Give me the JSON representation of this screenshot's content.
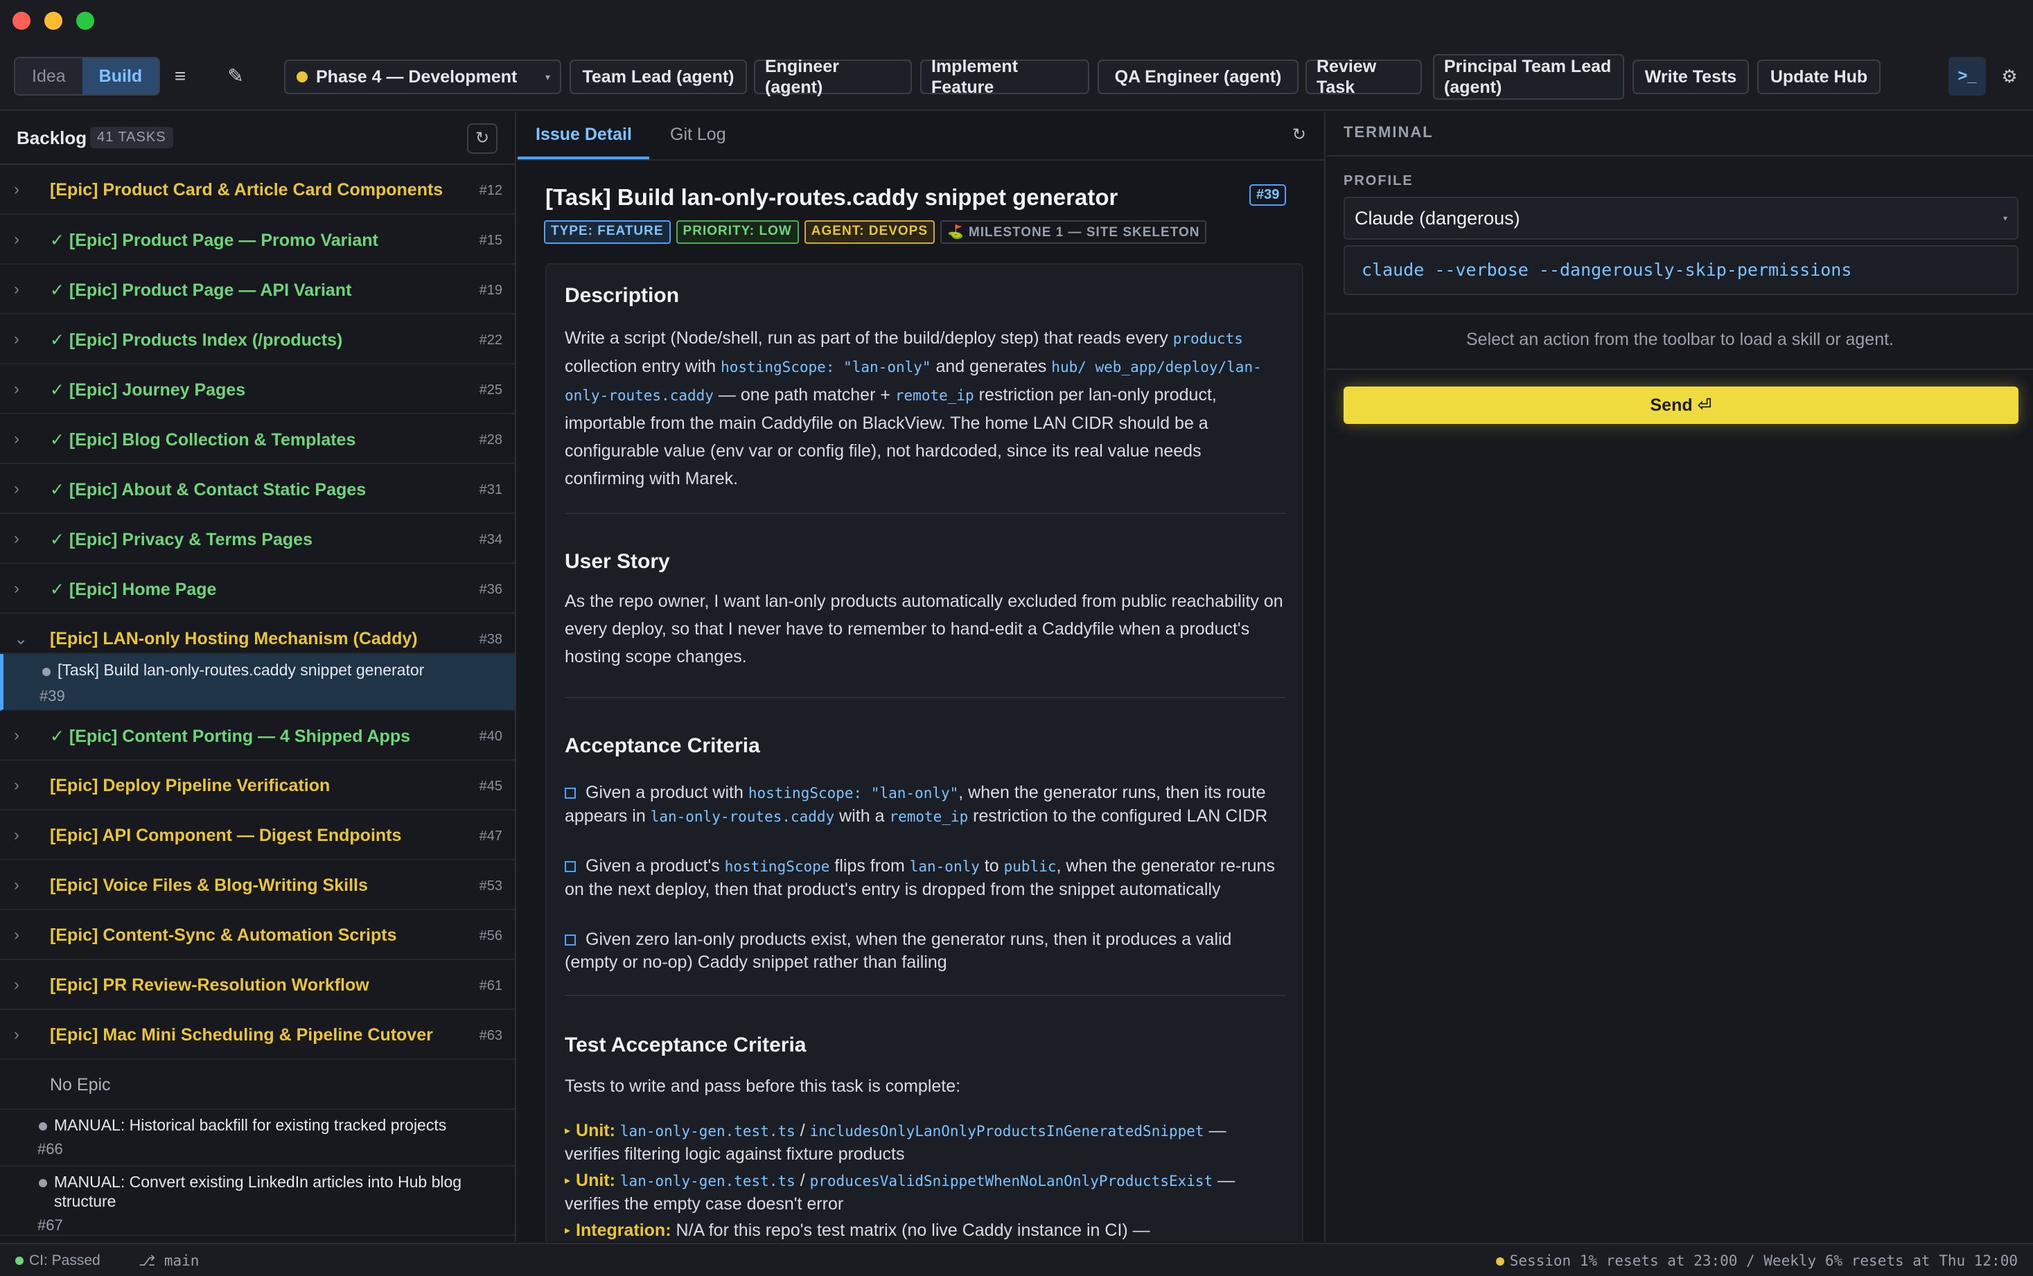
{
  "toolbar": {
    "mode_idea": "Idea",
    "mode_build": "Build",
    "menu_icon": "≡",
    "edit_icon": "✎",
    "phase": "Phase 4 — Development",
    "actions": [
      "Team Lead (agent)",
      "Engineer (agent)",
      "Implement Feature",
      "QA Engineer (agent)",
      "Review Task",
      "Principal Team Lead (agent)",
      "Write Tests",
      "Update Hub"
    ],
    "terminal_icon": ">_",
    "settings_icon": "⚙",
    "colors": {
      "accent": "#4aa3ff",
      "phase_dot": "#e8c53a"
    }
  },
  "sidebar": {
    "title": "Backlog",
    "count": "41 TASKS",
    "refresh_icon": "↻",
    "items": [
      {
        "title": "[Epic] Product Card & Article Card Components",
        "num": "#12",
        "done": false
      },
      {
        "title": "✓ [Epic] Product Page — Promo Variant",
        "num": "#15",
        "done": true
      },
      {
        "title": "✓ [Epic] Product Page — API Variant",
        "num": "#19",
        "done": true
      },
      {
        "title": "✓ [Epic] Products Index (/products)",
        "num": "#22",
        "done": true
      },
      {
        "title": "✓ [Epic] Journey Pages",
        "num": "#25",
        "done": true
      },
      {
        "title": "✓ [Epic] Blog Collection & Templates",
        "num": "#28",
        "done": true
      },
      {
        "title": "✓ [Epic] About & Contact Static Pages",
        "num": "#31",
        "done": true
      },
      {
        "title": "✓ [Epic] Privacy & Terms Pages",
        "num": "#34",
        "done": true
      },
      {
        "title": "✓ [Epic] Home Page",
        "num": "#36",
        "done": true
      },
      {
        "title": "[Epic] LAN-only Hosting Mechanism (Caddy)",
        "num": "#38",
        "done": false
      }
    ],
    "selected_task": {
      "title": "[Task] Build lan-only-routes.caddy snippet generator",
      "num": "#39"
    },
    "items2": [
      {
        "title": "✓ [Epic] Content Porting — 4 Shipped Apps",
        "num": "#40",
        "done": true
      },
      {
        "title": "[Epic] Deploy Pipeline Verification",
        "num": "#45",
        "done": false
      },
      {
        "title": "[Epic] API Component — Digest Endpoints",
        "num": "#47",
        "done": false
      },
      {
        "title": "[Epic] Voice Files & Blog-Writing Skills",
        "num": "#53",
        "done": false
      },
      {
        "title": "[Epic] Content-Sync & Automation Scripts",
        "num": "#56",
        "done": false
      },
      {
        "title": "[Epic] PR Review-Resolution Workflow",
        "num": "#61",
        "done": false
      },
      {
        "title": "[Epic] Mac Mini Scheduling & Pipeline Cutover",
        "num": "#63",
        "done": false
      }
    ],
    "no_epic": "No Epic",
    "manual": [
      {
        "title": "MANUAL: Historical backfill for existing tracked projects",
        "num": "#66"
      },
      {
        "title": "MANUAL: Convert existing LinkedIn articles into Hub blog structure",
        "num": "#67"
      }
    ]
  },
  "middle": {
    "tab_active": "Issue Detail",
    "tab_inactive": "Git Log",
    "title": "[Task] Build lan-only-routes.caddy snippet generator",
    "num": "#39",
    "badges": {
      "type": "TYPE: FEATURE",
      "priority": "PRIORITY: LOW",
      "agent": "AGENT: DEVOPS",
      "milestone": "⛳ MILESTONE 1 — SITE SKELETON"
    },
    "description_heading": "Description",
    "user_story_heading": "User Story",
    "user_story": "As the repo owner, I want lan-only products automatically excluded from public reachability on every deploy, so that I never have to remember to hand-edit a Caddyfile when a product's hosting scope changes.",
    "acceptance_heading": "Acceptance Criteria",
    "test_heading": "Test Acceptance Criteria",
    "test_intro": "Tests to write and pass before this task is complete:"
  },
  "terminal": {
    "title": "TERMINAL",
    "profile_label": "PROFILE",
    "profile": "Claude (dangerous)",
    "command": "claude --verbose --dangerously-skip-permissions",
    "hint": "Select an action from the toolbar to load a skill or agent.",
    "send": "Send ⏎"
  },
  "statusbar": {
    "ci": "CI: Passed",
    "branch": "⎇ main",
    "session": "Session 1% resets at 23:00 / Weekly 6% resets at Thu 12:00"
  }
}
